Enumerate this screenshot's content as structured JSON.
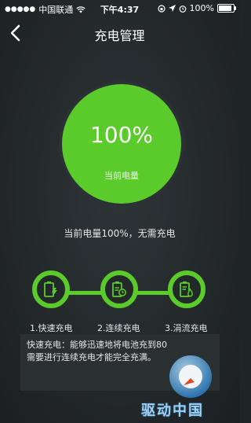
{
  "status_bar": {
    "carrier": "中国联通",
    "time": "下午4:37",
    "battery_text": "100%",
    "battery_level": 1.0
  },
  "nav": {
    "title": "充电管理"
  },
  "charge": {
    "percent_text": "100%",
    "label": "当前电量",
    "message": "当前电量100%，无需充电"
  },
  "stages": [
    {
      "label": "1.快速充电",
      "icon": "fast-charge-icon"
    },
    {
      "label": "2.连续充电",
      "icon": "continuous-charge-icon"
    },
    {
      "label": "3.涓流充电",
      "icon": "trickle-charge-icon"
    }
  ],
  "info": {
    "line1": "快速充电：能够迅速地将电池充到80",
    "line2": "需要进行连续充电才能完全充满。"
  },
  "watermark": {
    "text": "驱动中国"
  },
  "colors": {
    "accent": "#5acb2a",
    "background": "#24292c"
  }
}
